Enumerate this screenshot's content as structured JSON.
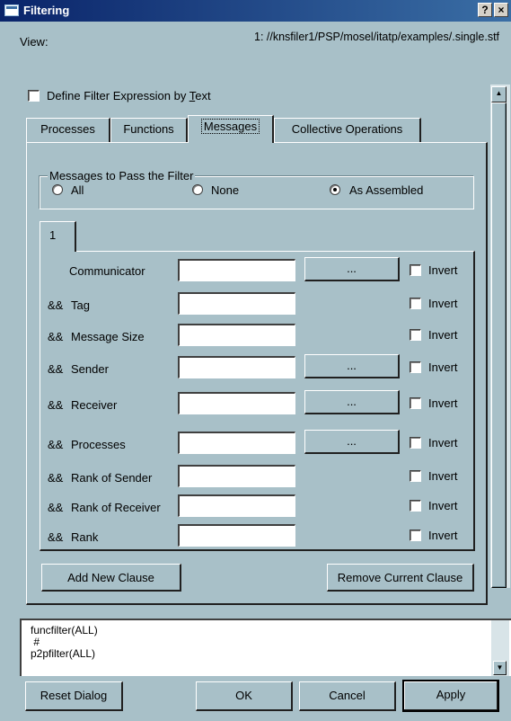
{
  "window": {
    "title": "Filtering",
    "help_label": "?",
    "close_label": "×"
  },
  "view": {
    "label": "View:",
    "path": "1: //knsfiler1/PSP/mosel/itatp/examples/.single.stf"
  },
  "define_filter": {
    "label_prefix": "Define Filter Expression by ",
    "label_mnemonic": "T",
    "label_suffix": "ext",
    "checked": false
  },
  "tabs": [
    {
      "label": "Processes",
      "active": false
    },
    {
      "label": "Functions",
      "active": false
    },
    {
      "label": "Messages",
      "active": true
    },
    {
      "label": "Collective Operations",
      "active": false
    }
  ],
  "messages_group": {
    "legend": "Messages to Pass the Filter",
    "options": [
      {
        "label": "All",
        "selected": false
      },
      {
        "label": "None",
        "selected": false
      },
      {
        "label": "As Assembled",
        "selected": true
      }
    ]
  },
  "clause_tab": "1",
  "rows": [
    {
      "prefix": "",
      "label": "Communicator",
      "value": "",
      "has_button": true,
      "button_label": "...",
      "invert_label": "Invert"
    },
    {
      "prefix": "&&",
      "label": "Tag",
      "value": "",
      "has_button": false,
      "button_label": "",
      "invert_label": "Invert"
    },
    {
      "prefix": "&&",
      "label": "Message Size",
      "value": "",
      "has_button": false,
      "button_label": "",
      "invert_label": "Invert"
    },
    {
      "prefix": "&&",
      "label": "Sender",
      "value": "",
      "has_button": true,
      "button_label": "...",
      "invert_label": "Invert"
    },
    {
      "prefix": "&&",
      "label": "Receiver",
      "value": "",
      "has_button": true,
      "button_label": "...",
      "invert_label": "Invert"
    },
    {
      "prefix": "&&",
      "label": "Processes",
      "value": "",
      "has_button": true,
      "button_label": "...",
      "invert_label": "Invert"
    },
    {
      "prefix": "&&",
      "label": "Rank of Sender",
      "value": "",
      "has_button": false,
      "button_label": "",
      "invert_label": "Invert"
    },
    {
      "prefix": "&&",
      "label": "Rank of Receiver",
      "value": "",
      "has_button": false,
      "button_label": "",
      "invert_label": "Invert"
    },
    {
      "prefix": "&&",
      "label": "Rank",
      "value": "",
      "has_button": false,
      "button_label": "",
      "invert_label": "Invert"
    }
  ],
  "clause_buttons": {
    "add": "Add New Clause",
    "remove": "Remove Current Clause"
  },
  "expression_lines": [
    "funcfilter(ALL)",
    " #",
    "p2pfilter(ALL)"
  ],
  "bottom_buttons": {
    "reset": "Reset Dialog",
    "ok": "OK",
    "cancel": "Cancel",
    "apply": "Apply"
  },
  "icons": {
    "scroll_up": "scroll-up-arrow-icon",
    "scroll_down": "scroll-down-arrow-icon",
    "window": "window-icon"
  }
}
